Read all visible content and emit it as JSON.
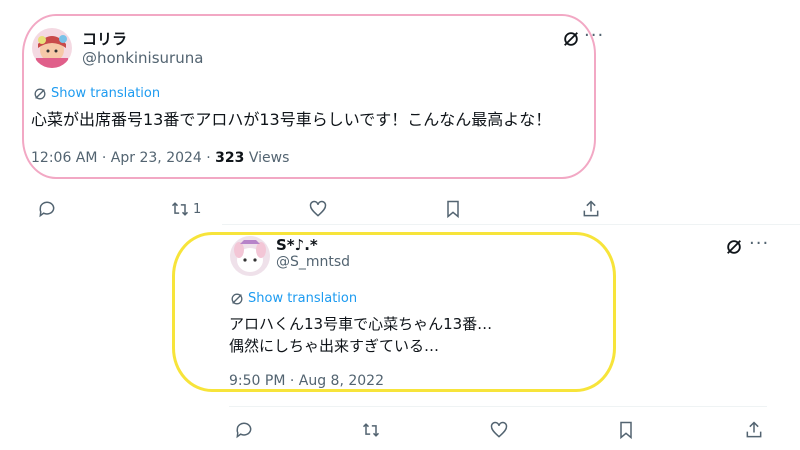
{
  "tweets": [
    {
      "name": "コリラ",
      "handle": "@honkinisuruna",
      "translate_label": "Show translation",
      "text": "心菜が出席番号13番でアロハが13号車らしいです！こんなん最高よな！",
      "time": "12:06 AM · Apr 23, 2024 · ",
      "views_count": "323",
      "views_label": " Views",
      "retweet_count": "1",
      "more": "···",
      "highlight_color": "#f2a8c4"
    },
    {
      "name": "S*♪.*",
      "handle": "@S_mntsd",
      "translate_label": "Show translation",
      "text_line1": "アロハくん13号車で心菜ちゃん13番…",
      "text_line2": "偶然にしちゃ出来すぎている…",
      "time": "9:50 PM · Aug 8, 2022",
      "more": "···",
      "highlight_color": "#f7e43a"
    }
  ],
  "icons": {
    "reply": "reply-icon",
    "retweet": "retweet-icon",
    "like": "like-icon",
    "bookmark": "bookmark-icon",
    "share": "share-icon",
    "grok": "grok-icon",
    "translate": "translate-icon"
  },
  "colors": {
    "link": "#1d9bf0",
    "secondary_text": "#536471",
    "primary_text": "#0f1419"
  }
}
